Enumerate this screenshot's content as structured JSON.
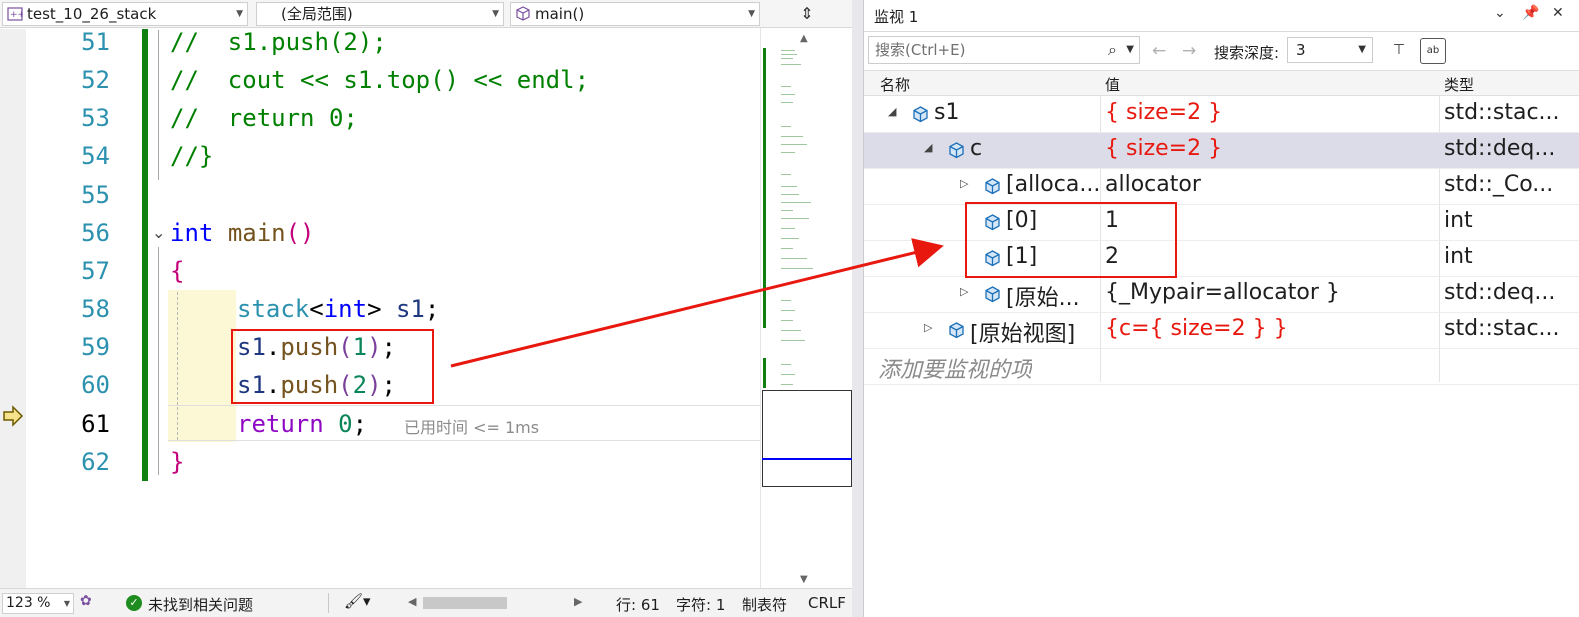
{
  "editor": {
    "nav": {
      "project": "test_10_26_stack",
      "scope": "(全局范围)",
      "member": "main()"
    },
    "lines": [
      {
        "num": "51"
      },
      {
        "num": "52"
      },
      {
        "num": "53"
      },
      {
        "num": "54"
      },
      {
        "num": "55"
      },
      {
        "num": "56"
      },
      {
        "num": "57"
      },
      {
        "num": "58"
      },
      {
        "num": "59"
      },
      {
        "num": "60"
      },
      {
        "num": "61"
      },
      {
        "num": "62"
      }
    ],
    "code": {
      "l51": {
        "a": "//  ",
        "b": "s1.push(2);"
      },
      "l52": {
        "a": "//  ",
        "b": "cout << s1.top() << endl;"
      },
      "l53": {
        "a": "//  ",
        "b": "return 0;"
      },
      "l54": {
        "a": "//}"
      },
      "l56": {
        "kw": "int",
        "fn": "main",
        "p": "()"
      },
      "l57": {
        "brace": "{"
      },
      "l58": {
        "type": "stack",
        "lt": "<",
        "kw": "int",
        "gt": ">",
        "var": " s1",
        "semi": ";"
      },
      "l59": {
        "var": "s1",
        "dot": ".",
        "fn": "push",
        "po": "(",
        "num": "1",
        "pc": ")",
        "semi": ";"
      },
      "l60": {
        "var": "s1",
        "dot": ".",
        "fn": "push",
        "po": "(",
        "num": "2",
        "pc": ")",
        "semi": ";"
      },
      "l61": {
        "kw": "return",
        "sp": " ",
        "num": "0",
        "semi": ";"
      },
      "l62": {
        "brace": "}"
      }
    },
    "perf_tip": "已用时间 <= 1ms",
    "status": {
      "zoom": "123 %",
      "issues": "未找到相关问题",
      "line": "行: 61",
      "char": "字符: 1",
      "tabs": "制表符",
      "eol": "CRLF"
    }
  },
  "watch": {
    "title": "监视 1",
    "search_placeholder": "搜索(Ctrl+E)",
    "depth_label": "搜索深度:",
    "depth_value": "3",
    "columns": {
      "name": "名称",
      "value": "值",
      "type": "类型"
    },
    "rows": [
      {
        "name": "s1",
        "value": "{ size=2 }",
        "type": "std::stac..."
      },
      {
        "name": "c",
        "value": "{ size=2 }",
        "type": "std::deq..."
      },
      {
        "name": "[alloca...",
        "value": "allocator",
        "type": "std::_Co..."
      },
      {
        "name": "[0]",
        "value": "1",
        "type": "int"
      },
      {
        "name": "[1]",
        "value": "2",
        "type": "int"
      },
      {
        "name": "[原始...",
        "value": "{_Mypair=allocator }",
        "type": "std::deq..."
      },
      {
        "name": "[原始视图]",
        "value": "{c={ size=2 } }",
        "type": "std::stac..."
      }
    ],
    "add_placeholder": "添加要监视的项"
  },
  "colors": {
    "accent_red": "#e8180f",
    "comment_green": "#008000",
    "keyword_blue": "#0000ff",
    "line_number": "#2b91af"
  }
}
